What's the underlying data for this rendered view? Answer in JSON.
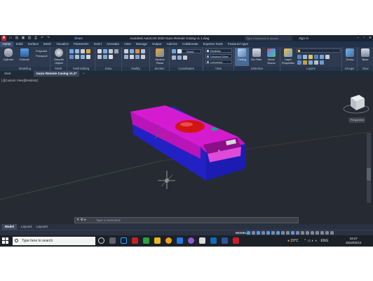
{
  "titlebar": {
    "logo": "A",
    "share": "Share",
    "title": "Autodesk AutoCAD 2022   Isuzu Remote Casing v1.1.dwg",
    "search_placeholder": "Type a keyword or phrase",
    "signin": "Sign In"
  },
  "ribbon_tabs": [
    "Home",
    "Solid",
    "Surface",
    "Mesh",
    "Visualize",
    "Parametric",
    "Insert",
    "Annotate",
    "View",
    "Manage",
    "Output",
    "Add-ins",
    "Collaborate",
    "Express Tools",
    "Featured Apps"
  ],
  "ribbon": {
    "cylinder": "Cylinder",
    "extrude": "Extrude",
    "polysolid": "Polysolid",
    "presspull": "Presspull",
    "smooth_object": "Smooth Object",
    "section_plane": "Section Plane",
    "unsaved_view": "Unsaved View",
    "realistic": "Realistic",
    "unnamed": "Unnamed",
    "world": "World",
    "culling": "Culling",
    "no_filter": "No Filter",
    "move_gizmo": "Move Gizmo",
    "layer_properties": "Layer Properties",
    "group": "Group",
    "base": "Base",
    "panels": [
      "Modeling",
      "Mesh",
      "Solid Editing",
      "Draw",
      "Modify",
      "Section",
      "Coordinates",
      "View",
      "Selection",
      "Layers",
      "Groups",
      "View"
    ]
  },
  "file_tabs": {
    "start": "Start",
    "doc": "Isuzu Remote Casing v1.1*",
    "plus": "+"
  },
  "viewport": {
    "label": "[-][Custom View][Realistic]",
    "viewcube": "Perspective"
  },
  "command_line": {
    "placeholder": "Type a command"
  },
  "layout_tabs": [
    "Model",
    "Layout1",
    "Layout2"
  ],
  "status": {
    "model": "MODEL"
  },
  "taskbar": {
    "search_text": "Type here to search",
    "weather": "23°C",
    "lang": "ENG",
    "time": "19:27",
    "date": "2022/02/12"
  },
  "colors": {
    "housing_magenta": "#d51bd0",
    "housing_blue": "#2020d8",
    "dome_red": "#d11515",
    "viewport_bg": "#262b33"
  }
}
